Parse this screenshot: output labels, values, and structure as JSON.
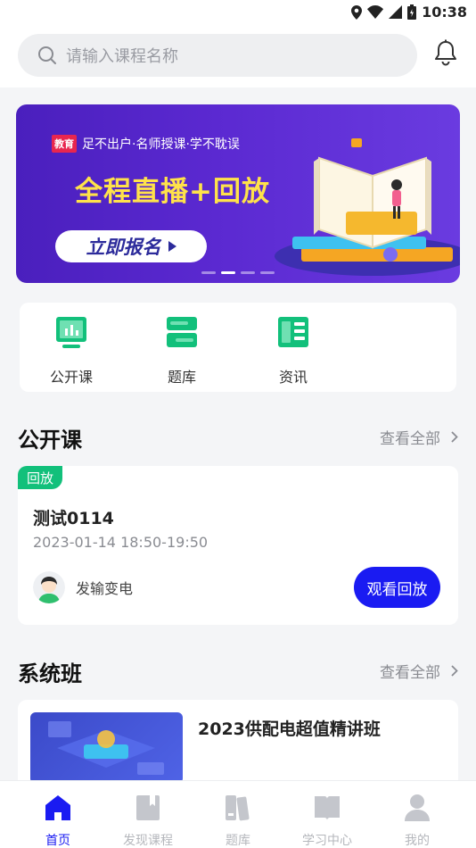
{
  "status_bar": {
    "time": "10:38"
  },
  "search": {
    "placeholder": "请输入课程名称"
  },
  "banner": {
    "badge": "教育",
    "tagline": "足不出户·名师授课·学不耽误",
    "headline": "全程直播+回放",
    "cta_label": "立即报名",
    "page_count": 4,
    "active_page": 2
  },
  "quick_links": [
    {
      "label": "公开课",
      "icon": "monitor-chart-icon"
    },
    {
      "label": "题库",
      "icon": "question-bank-icon"
    },
    {
      "label": "资讯",
      "icon": "news-icon"
    }
  ],
  "open_courses": {
    "title": "公开课",
    "more_label": "查看全部",
    "card": {
      "tag": "回放",
      "title": "测试0114",
      "datetime": "2023-01-14   18:50-19:50",
      "teacher": "发输变电",
      "action_label": "观看回放"
    }
  },
  "system_classes": {
    "title": "系统班",
    "more_label": "查看全部",
    "card": {
      "title": "2023供配电超值精讲班"
    }
  },
  "tab_bar": [
    {
      "label": "首页",
      "icon": "home-icon",
      "active": true
    },
    {
      "label": "发现课程",
      "icon": "bookmark-icon",
      "active": false
    },
    {
      "label": "题库",
      "icon": "books-icon",
      "active": false
    },
    {
      "label": "学习中心",
      "icon": "open-book-icon",
      "active": false
    },
    {
      "label": "我的",
      "icon": "user-icon",
      "active": false
    }
  ],
  "colors": {
    "primary": "#1a1bf2",
    "replay_tag": "#12c07b",
    "headline": "#ffe24a",
    "quick_icon": "#12c07b"
  }
}
